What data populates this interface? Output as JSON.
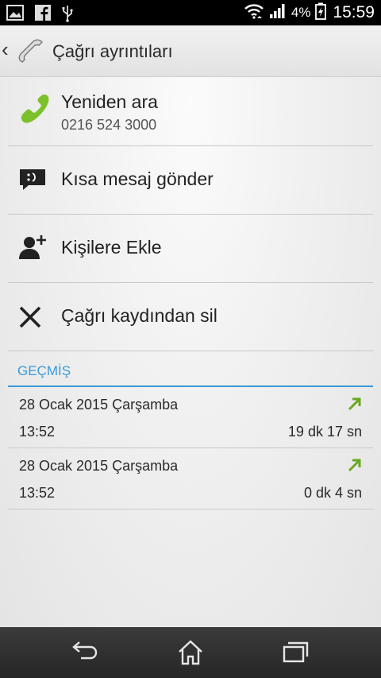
{
  "statusbar": {
    "battery_percent": "4%",
    "time": "15:59",
    "left_icons": [
      "gallery-icon",
      "facebook-icon",
      "usb-icon"
    ],
    "right_icons": [
      "wifi-icon",
      "signal-icon",
      "battery-charging-icon"
    ]
  },
  "actionbar": {
    "title": "Çağrı ayrıntıları",
    "icon": "phone-handset-icon"
  },
  "actions": [
    {
      "label": "Yeniden ara",
      "sublabel": "0216 524 3000",
      "icon": "call-green-icon"
    },
    {
      "label": "Kısa mesaj gönder",
      "icon": "message-icon"
    },
    {
      "label": "Kişilere Ekle",
      "icon": "add-contact-icon"
    },
    {
      "label": "Çağrı kaydından sil",
      "icon": "delete-x-icon"
    }
  ],
  "history": {
    "header": "GEÇMİŞ",
    "entries": [
      {
        "date": "28 Ocak 2015 Çarşamba",
        "time": "13:52",
        "duration": "19 dk 17 sn",
        "icon": "outgoing-call-arrow-icon"
      },
      {
        "date": "28 Ocak 2015 Çarşamba",
        "time": "13:52",
        "duration": "0 dk 4 sn",
        "icon": "outgoing-call-arrow-icon"
      }
    ]
  },
  "navbar": {
    "buttons": [
      "back-icon",
      "home-icon",
      "recent-apps-icon"
    ]
  },
  "colors": {
    "accent_blue": "#3a9ad9",
    "call_green": "#7cc12a",
    "arrow_green": "#6aa820"
  }
}
